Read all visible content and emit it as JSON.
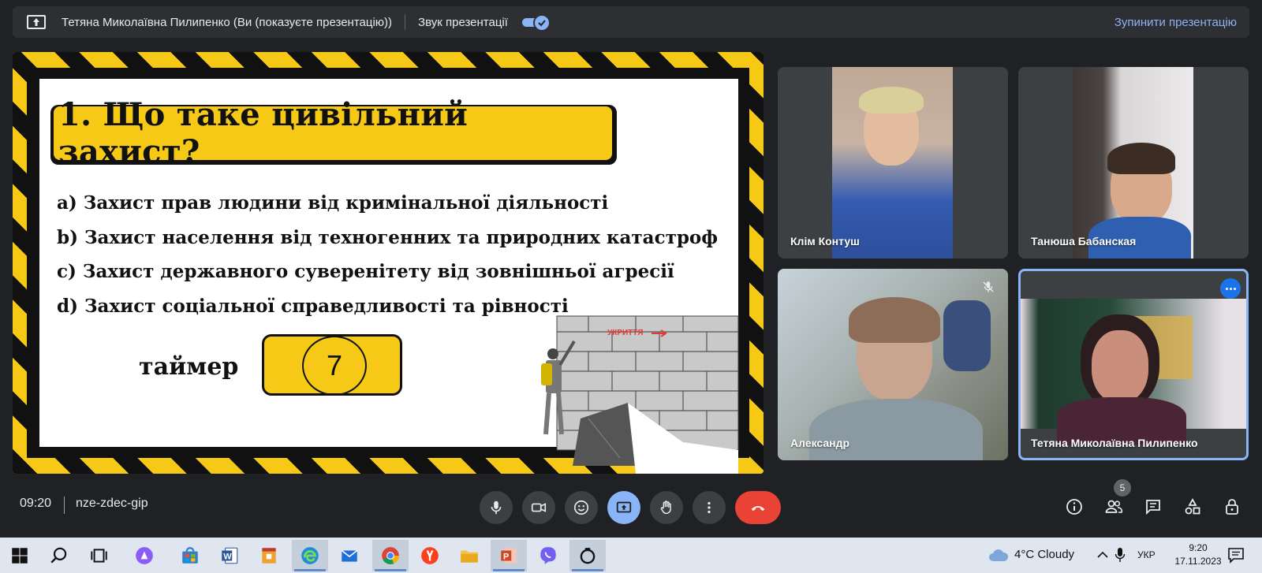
{
  "presentation_bar": {
    "presenter_text": "Тетяна Миколаївна Пилипенко (Ви (показуєте презентацію))",
    "audio_label": "Звук презентації",
    "stop_label": "Зупинити презентацію",
    "audio_enabled": true
  },
  "slide": {
    "title": "1. Що таке цивільний захист?",
    "answers": [
      "a) Захист прав людини від кримінальної діяльності",
      "b) Захист населення від техногенних та природних катастроф",
      "c) Захист державного суверенітету від зовнішньої агресії",
      "d) Захист соціальної справедливості та рівності"
    ],
    "timer_label": "таймер",
    "timer_value": "7",
    "sign_text": "УКРИТТЯ"
  },
  "participants": [
    {
      "name": "Клім Контуш",
      "muted": false
    },
    {
      "name": "Танюша Бабанская",
      "muted": false
    },
    {
      "name": "Александр",
      "muted": true
    },
    {
      "name": "Тетяна Миколаївна Пилипенко",
      "muted": false,
      "active_speaker": true
    }
  ],
  "meeting": {
    "time": "09:20",
    "code": "nze-zdec-gip",
    "participant_count": "5"
  },
  "controls": {
    "center": [
      "mic-icon",
      "camera-icon",
      "emoji-icon",
      "present-icon",
      "raise-hand-icon",
      "more-options-icon",
      "hangup-icon"
    ],
    "right": [
      "info-icon",
      "people-icon",
      "chat-icon",
      "activities-icon",
      "host-controls-icon"
    ]
  },
  "taskbar": {
    "weather": "4°C  Cloudy",
    "language": "УКР",
    "time": "9:20",
    "date": "17.11.2023"
  },
  "colors": {
    "meet_bg": "#202124",
    "accent": "#8ab4f8",
    "hangup": "#ea4335",
    "slide_yellow": "#f6c916"
  }
}
